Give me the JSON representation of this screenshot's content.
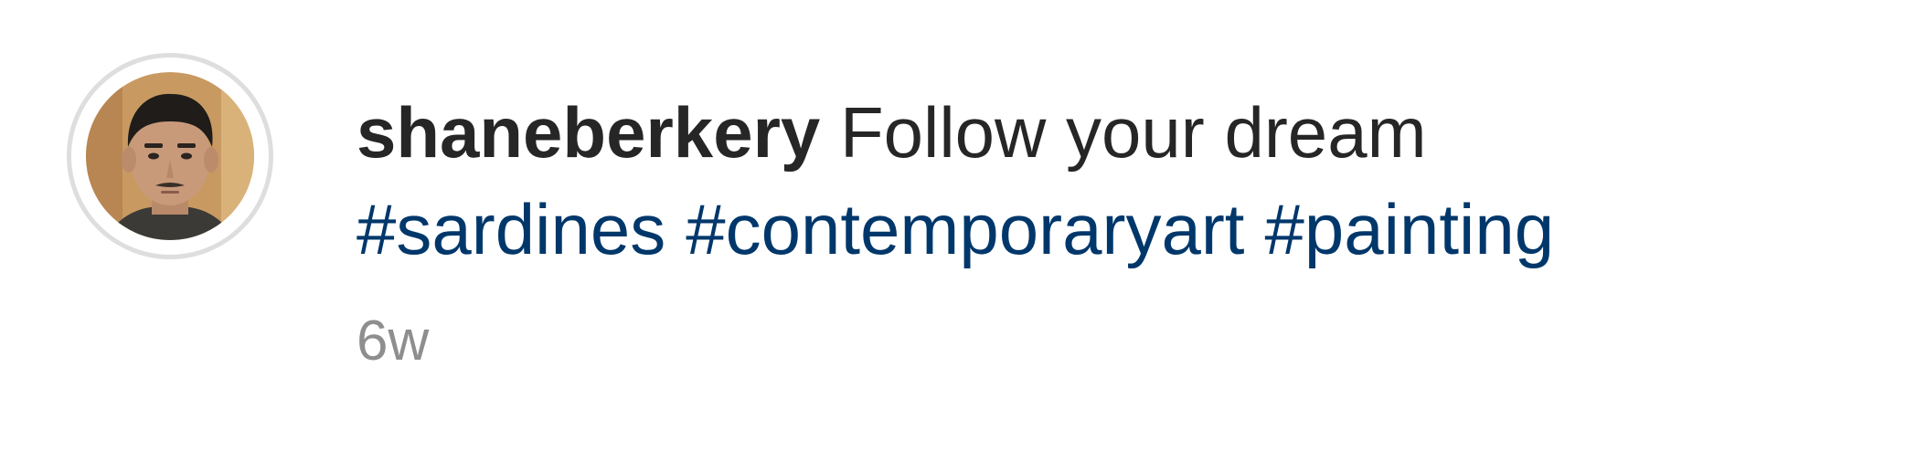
{
  "comment": {
    "username": "shaneberkery",
    "caption": "Follow your dream",
    "hashtags": [
      "#sardines",
      "#contemporaryart",
      "#painting"
    ],
    "timestamp": "6w"
  },
  "colors": {
    "text": "#262626",
    "hashtag": "#00376b",
    "timestamp": "#8e8e8e",
    "avatar_ring": "#dedede"
  }
}
